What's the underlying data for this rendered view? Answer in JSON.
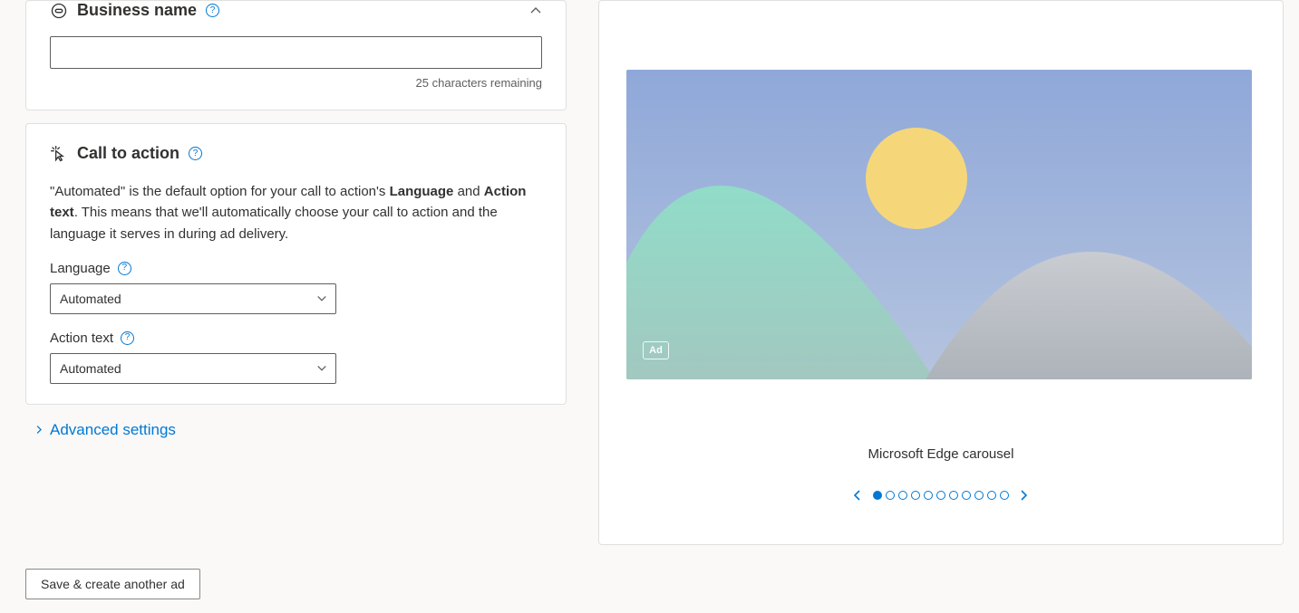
{
  "business_name": {
    "title": "Business name",
    "value": "",
    "remaining": "25 characters remaining"
  },
  "cta": {
    "title": "Call to action",
    "description_pre": "\"Automated\" is the default option for your call to action's ",
    "bold1": "Language",
    "mid": " and ",
    "bold2": "Action text",
    "description_post": ". This means that we'll automatically choose your call to action and the language it serves in during ad delivery.",
    "language_label": "Language",
    "language_value": "Automated",
    "action_label": "Action text",
    "action_value": "Automated"
  },
  "advanced": "Advanced settings",
  "save_button": "Save & create another ad",
  "preview": {
    "ad_badge": "Ad",
    "caption": "Microsoft Edge carousel",
    "dot_count": 11,
    "active_dot": 0
  }
}
